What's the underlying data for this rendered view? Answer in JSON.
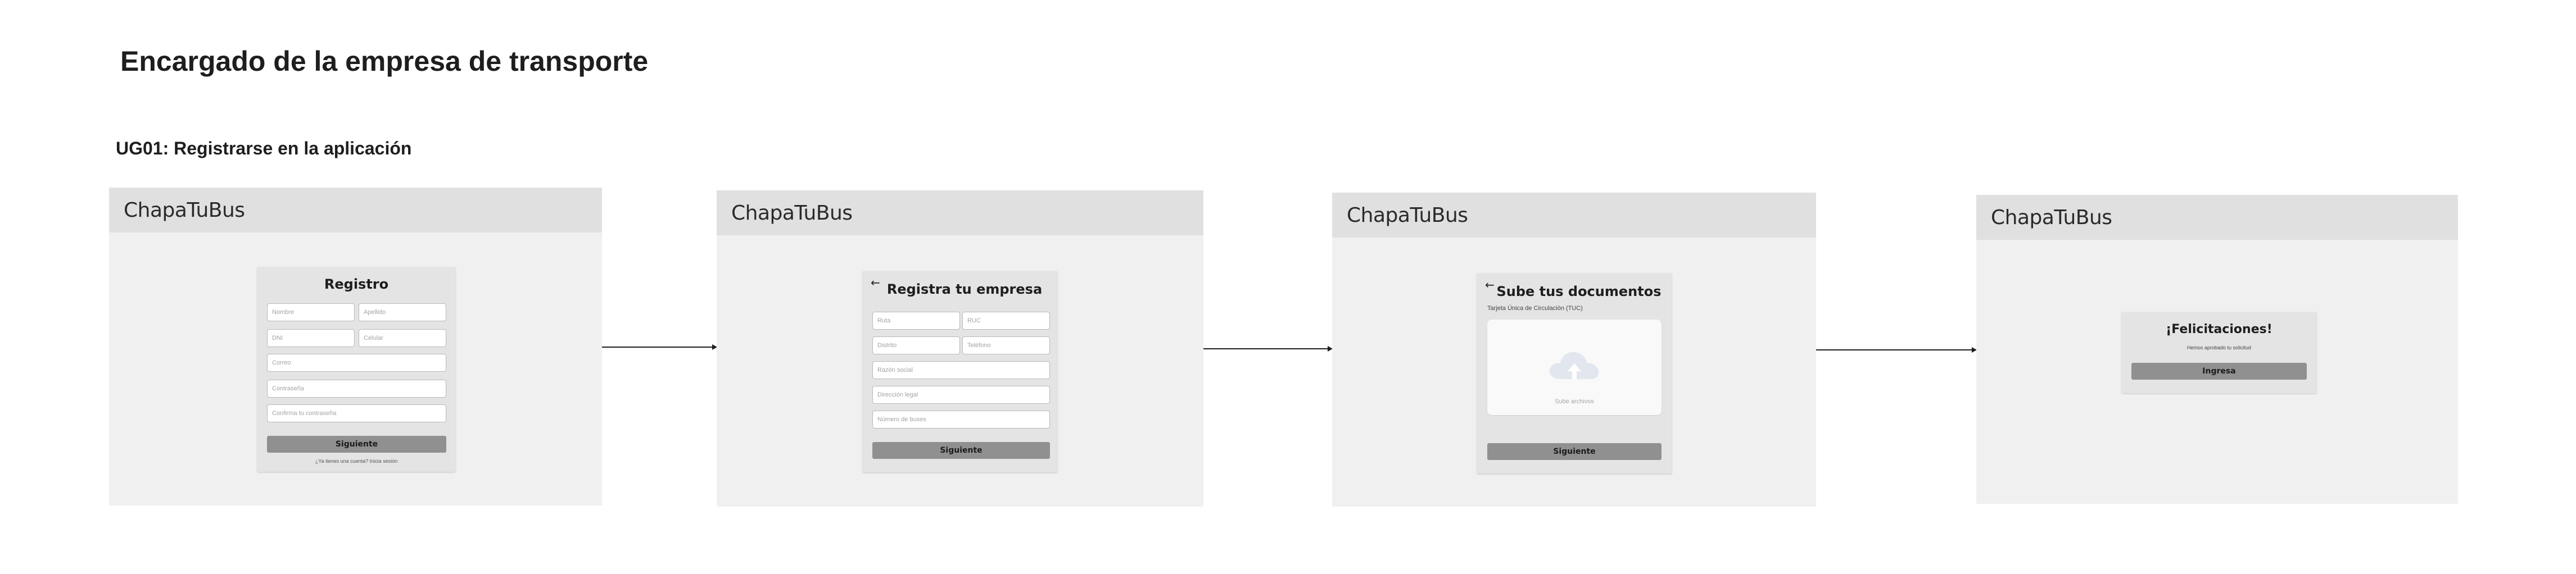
{
  "page": {
    "title": "Encargado de la empresa de transporte",
    "section": "UG01: Registrarse en la aplicación"
  },
  "app": {
    "logo": "ChapaTuBus"
  },
  "screens": {
    "registro": {
      "title": "Registro",
      "fields": {
        "nombre": "Nombre",
        "apellido": "Apellido",
        "dni": "DNI",
        "celular": "Celular",
        "correo": "Correo",
        "contrasena": "Contraseña",
        "confirma": "Confirma tu contraseña"
      },
      "button": "Siguiente",
      "login_link": "¿Ya tienes una cuenta? Inicia sesión"
    },
    "empresa": {
      "back": "←",
      "title": "Registra tu empresa",
      "fields": {
        "ruta": "Ruta",
        "ruc": "RUC",
        "distrito": "Distrito",
        "telefono": "Teléfono",
        "razon": "Razón social",
        "direccion": "Dirección legal",
        "buses": "Número de buses"
      },
      "button": "Siguiente"
    },
    "documentos": {
      "back": "←",
      "title": "Sube tus documentos",
      "doc_label": "Tarjeta Única de Circulación (TUC)",
      "upload_caption": "Sube archivos",
      "button": "Siguiente"
    },
    "felicitaciones": {
      "title": "¡Felicitaciones!",
      "message": "Hemos aprobado tu solicitud",
      "button": "Ingresa"
    }
  },
  "colors": {
    "frame_bg": "#f0f0f0",
    "topbar_bg": "#e0e0e0",
    "card_bg": "#e4e4e4",
    "button_bg": "#909090",
    "connector": "#1e1e1e"
  },
  "icons": [
    "back-arrow-icon",
    "cloud-upload-icon",
    "arrow-connector-icon"
  ]
}
